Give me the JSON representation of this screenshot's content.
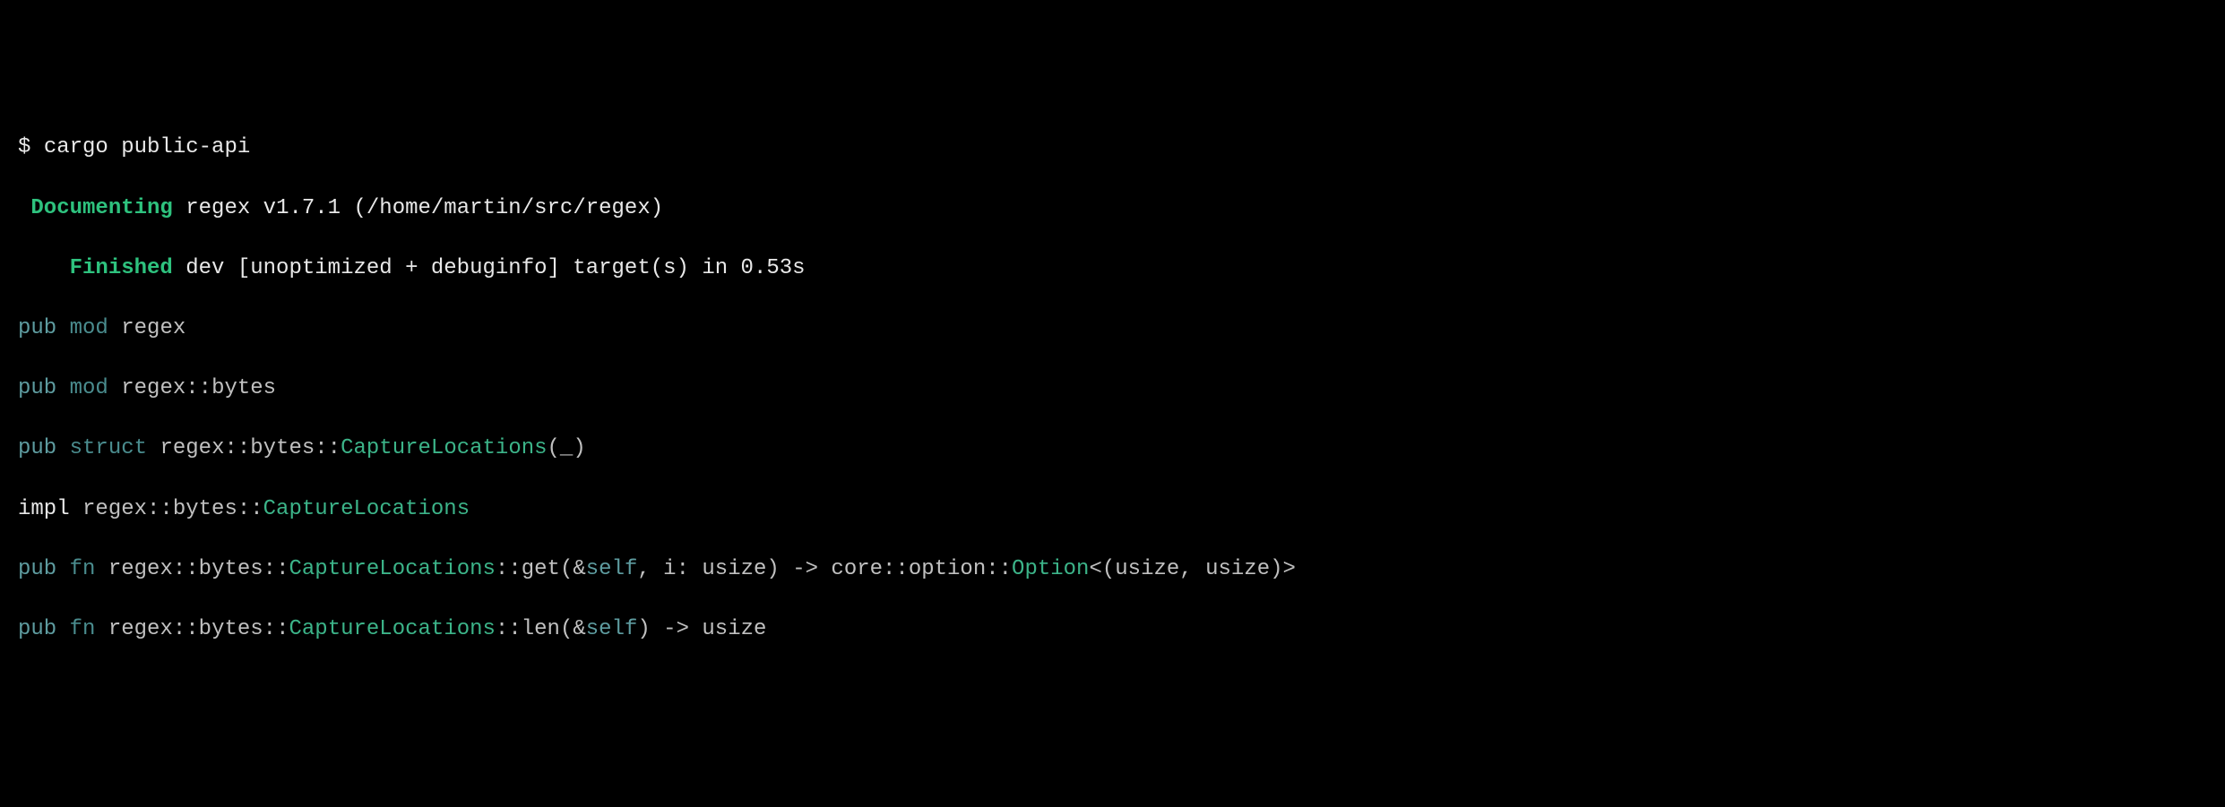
{
  "prompt": "$",
  "command": "cargo public-api",
  "phases": {
    "documenting": {
      "label": "Documenting",
      "text": "regex v1.7.1 (/home/martin/src/regex)"
    },
    "finished": {
      "label": "Finished",
      "text": "dev [unoptimized + debuginfo] target(s) in 0.53s"
    }
  },
  "api_lines": [
    {
      "qualifier": "pub",
      "kind": "mod",
      "path": "regex"
    },
    {
      "qualifier": "pub",
      "kind": "mod",
      "path": "regex::bytes"
    },
    {
      "qualifier": "pub",
      "kind": "struct",
      "path_prefix": "regex::bytes::",
      "type_name": "CaptureLocations",
      "suffix": "(_)"
    },
    {
      "kind": "impl",
      "path_prefix": "regex::bytes::",
      "type_name": "CaptureLocations"
    },
    {
      "qualifier": "pub",
      "kind": "fn",
      "path_prefix": "regex::bytes::",
      "type_name": "CaptureLocations",
      "fn_sep": "::",
      "fn_name": "get",
      "sig_open": "(&",
      "self_kw": "self",
      "sig_mid": ", i: usize) -> core::option::",
      "ret_type": "Option",
      "sig_close": "<(usize, usize)>"
    },
    {
      "qualifier": "pub",
      "kind": "fn",
      "path_prefix": "regex::bytes::",
      "type_name": "CaptureLocations",
      "fn_sep": "::",
      "fn_name": "len",
      "sig_open": "(&",
      "self_kw": "self",
      "sig_mid": ") -> usize",
      "ret_type": "",
      "sig_close": ""
    }
  ]
}
